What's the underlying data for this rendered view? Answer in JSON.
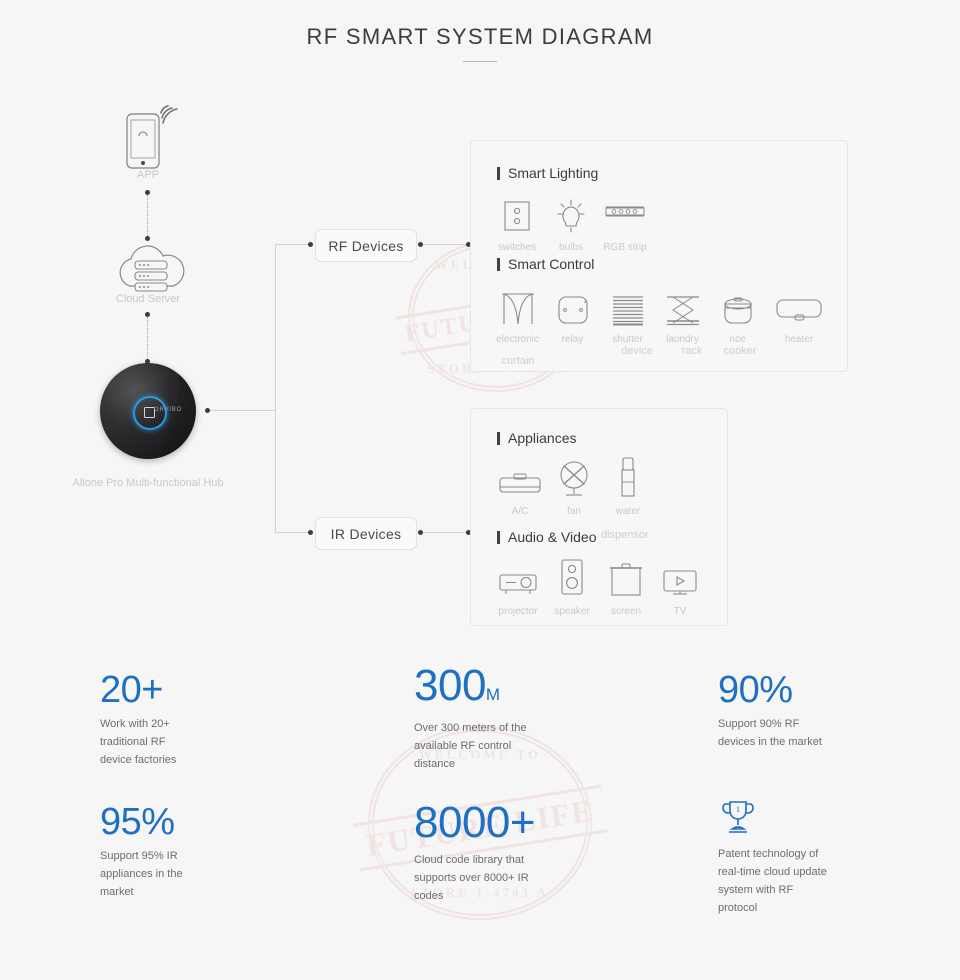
{
  "page": {
    "title": "RF SMART SYSTEM DIAGRAM",
    "background": "#f6f6f6",
    "accent": "#1f6fc4",
    "watermark_text": "FUTURE LIFE",
    "watermark_top": "WELCOME TO",
    "watermark_bottom": "STORE 1-4703 A"
  },
  "flow": {
    "app_label": "APP",
    "cloud_label": "Cloud Server",
    "hub_label": "Allone Pro Multi-functional Hub",
    "hub_brand": "ORVIBO",
    "rf_pill": "RF Devices",
    "ir_pill": "IR Devices"
  },
  "panels": [
    {
      "id": "rf-panel",
      "sections": [
        {
          "title": "Smart Lighting",
          "items": [
            {
              "icon": "wall-switch-icon",
              "label": "switches",
              "label2": ""
            },
            {
              "icon": "light-bulb-icon",
              "label": "bulbs",
              "label2": ""
            },
            {
              "icon": "rgb-strip-icon",
              "label": "RGB strip",
              "label2": ""
            }
          ]
        },
        {
          "title": "Smart Control",
          "items": [
            {
              "icon": "curtain-icon",
              "label": "electronic",
              "label2": "curtain"
            },
            {
              "icon": "relay-icon",
              "label": "relay",
              "label2": ""
            },
            {
              "icon": "shutter-icon",
              "label": "shutter",
              "label2": "device"
            },
            {
              "icon": "laundry-rack-icon",
              "label": "laundry",
              "label2": "rack"
            },
            {
              "icon": "rice-cooker-icon",
              "label": "rice",
              "label2": "cooker"
            },
            {
              "icon": "heater-icon",
              "label": "heater",
              "label2": ""
            }
          ]
        }
      ]
    },
    {
      "id": "ir-panel",
      "sections": [
        {
          "title": "Appliances",
          "items": [
            {
              "icon": "air-conditioner-icon",
              "label": "A/C",
              "label2": ""
            },
            {
              "icon": "fan-icon",
              "label": "fan",
              "label2": ""
            },
            {
              "icon": "water-dispenser-icon",
              "label": "water",
              "label2": "dispensor"
            }
          ]
        },
        {
          "title": "Audio & Video",
          "items": [
            {
              "icon": "projector-icon",
              "label": "projector",
              "label2": ""
            },
            {
              "icon": "speaker-icon",
              "label": "speaker",
              "label2": ""
            },
            {
              "icon": "screen-icon",
              "label": "screen",
              "label2": ""
            },
            {
              "icon": "tv-icon",
              "label": "TV",
              "label2": ""
            }
          ]
        }
      ]
    }
  ],
  "stats": [
    {
      "value": "20+",
      "unit": "",
      "text": "Work with 20+ traditional RF device factories"
    },
    {
      "value": "300",
      "unit": "M",
      "text": "Over 300 meters of the available RF control distance"
    },
    {
      "value": "90%",
      "unit": "",
      "text": "Support 90% RF devices in the market"
    },
    {
      "value": "95%",
      "unit": "",
      "text": "Support 95% IR appliances in the market"
    },
    {
      "value": "8000+",
      "unit": "",
      "text": "Cloud code library that supports over 8000+ IR codes"
    },
    {
      "value": "",
      "unit": "",
      "icon": "trophy-icon",
      "text": "Patent technology of real-time cloud update system with RF protocol"
    }
  ]
}
